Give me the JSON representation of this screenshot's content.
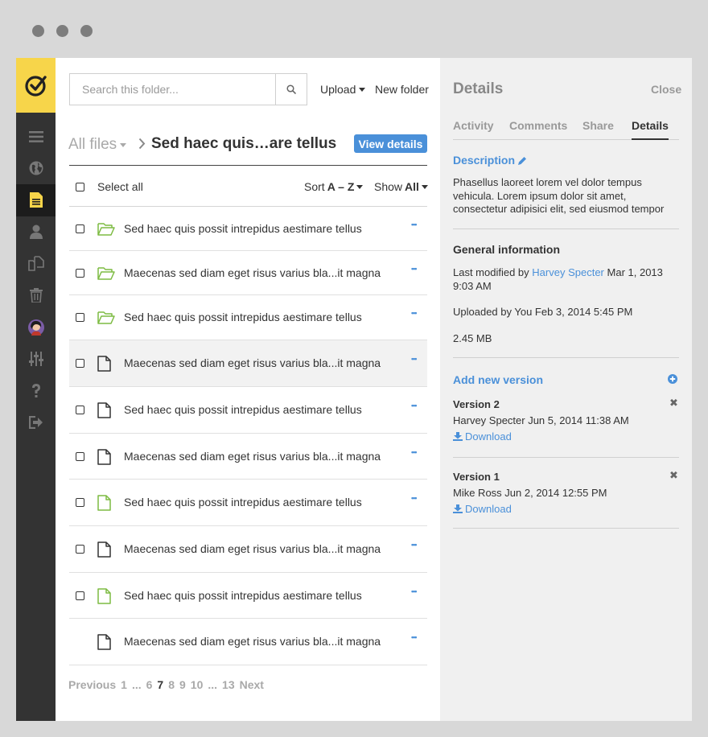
{
  "window": {
    "controls": [
      "dot",
      "dot",
      "dot"
    ]
  },
  "colors": {
    "accent": "#4a90d9",
    "sidebar": "#333333",
    "logo_bg": "#f7d54a",
    "folder_green": "#7dbb42"
  },
  "sidebar": {
    "items": [
      {
        "icon": "menu-icon"
      },
      {
        "icon": "globe-icon"
      },
      {
        "icon": "document-icon",
        "active": true
      },
      {
        "icon": "user-icon"
      },
      {
        "icon": "copy-icon"
      },
      {
        "icon": "trash-icon"
      },
      {
        "icon": "avatar"
      },
      {
        "icon": "sliders-icon"
      },
      {
        "icon": "help-icon"
      },
      {
        "icon": "logout-icon"
      }
    ]
  },
  "toolbar": {
    "search_placeholder": "Search this folder...",
    "upload_label": "Upload",
    "new_folder_label": "New folder"
  },
  "breadcrumb": {
    "all_files": "All files",
    "current": "Sed haec quis…are tellus",
    "view_details": "View details"
  },
  "list": {
    "select_all": "Select all",
    "sort_label": "Sort",
    "sort_value": "A – Z",
    "show_label": "Show",
    "show_value": "All",
    "more": "•••",
    "rows": [
      {
        "name": "Sed haec quis possit intrepidus aestimare tellus",
        "type": "folder"
      },
      {
        "name": "Maecenas sed diam eget risus varius bla...it magna",
        "type": "folder"
      },
      {
        "name": "Sed haec quis possit intrepidus aestimare tellus",
        "type": "folder"
      },
      {
        "name": "Maecenas sed diam eget risus varius bla...it magna",
        "type": "file",
        "highlighted": true
      },
      {
        "name": "Sed haec quis possit intrepidus aestimare tellus",
        "type": "file"
      },
      {
        "name": "Maecenas sed diam eget risus varius bla...it magna",
        "type": "file"
      },
      {
        "name": "Sed haec quis possit intrepidus aestimare tellus",
        "type": "file-green"
      },
      {
        "name": "Maecenas sed diam eget risus varius bla...it magna",
        "type": "file"
      },
      {
        "name": "Sed haec quis possit intrepidus aestimare tellus",
        "type": "file-green"
      },
      {
        "name": "Maecenas sed diam eget risus varius bla...it magna",
        "type": "file",
        "no_checkbox": true
      }
    ]
  },
  "pagination": {
    "previous": "Previous",
    "pages": [
      "1",
      "...",
      "6",
      "7",
      "8",
      "9",
      "10",
      "...",
      "13"
    ],
    "current": "7",
    "next": "Next"
  },
  "details": {
    "title": "Details",
    "close": "Close",
    "tabs": [
      "Activity",
      "Comments",
      "Share",
      "Details"
    ],
    "active_tab": "Details",
    "description_heading": "Description",
    "description": "Phasellus laoreet lorem vel dolor tempus vehicula. Lorem ipsum dolor sit amet, consectetur adipisici elit, sed eiusmod tempor",
    "general_heading": "General information",
    "modified_prefix": "Last modified by",
    "modified_user": "Harvey Specter",
    "modified_date": "Mar 1, 2013 9:03 AM",
    "uploaded": "Uploaded by You Feb 3, 2014 5:45 PM",
    "size": "2.45 MB",
    "add_version": "Add new version",
    "versions": [
      {
        "title": "Version 2",
        "meta": "Harvey Specter Jun 5, 2014 11:38 AM",
        "download": "Download"
      },
      {
        "title": "Version 1",
        "meta": "Mike Ross Jun 2, 2014 12:55 PM",
        "download": "Download"
      }
    ]
  }
}
